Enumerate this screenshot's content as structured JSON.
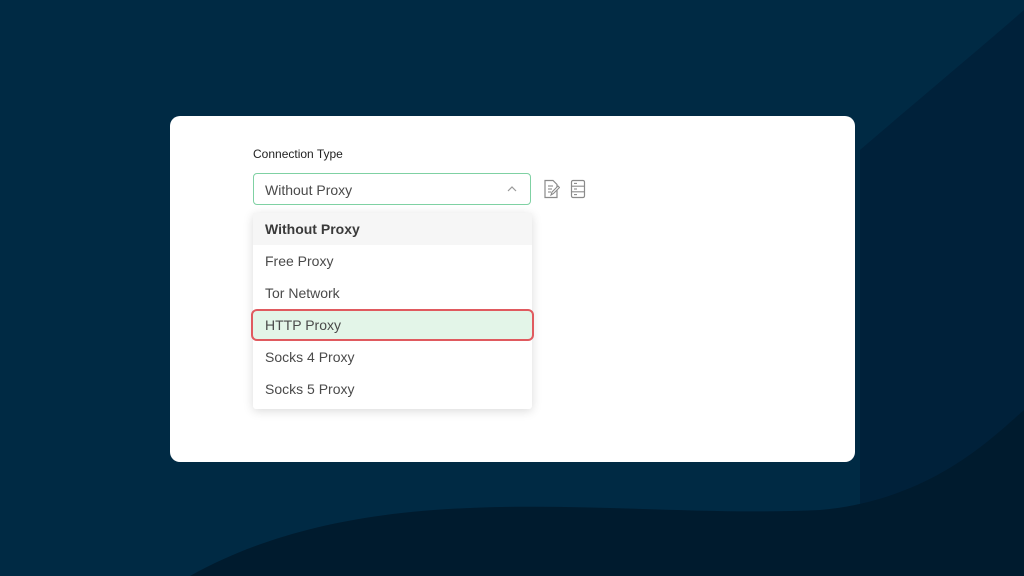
{
  "connection": {
    "label": "Connection Type",
    "selected_value": "Without Proxy"
  },
  "icons": {
    "chevron": "chevron-up-icon",
    "edit": "edit-document-icon",
    "list": "server-list-icon"
  },
  "dropdown": {
    "options": [
      "Without Proxy",
      "Free Proxy",
      "Tor Network",
      "HTTP Proxy",
      "Socks 4 Proxy",
      "Socks 5 Proxy"
    ],
    "selected_option": "Without Proxy",
    "highlighted_option": "HTTP Proxy"
  },
  "colors": {
    "background": "#002a44",
    "select_border": "#7fd1a3",
    "highlight_fill": "#e3f5e8",
    "highlight_border": "#e05a5f"
  }
}
